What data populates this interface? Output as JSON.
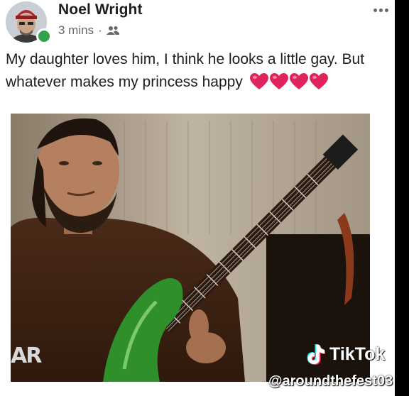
{
  "post": {
    "author": "Noel Wright",
    "time": "3 mins",
    "separator": "·",
    "audience_icon": "friends-icon",
    "text": "My daughter loves him, I think he looks a little gay. But whatever makes my princess happy",
    "hearts_count": 4,
    "heart_color": "#e0245e"
  },
  "media": {
    "channel_logo": "AR"
  },
  "overlay": {
    "brand": "TikTok",
    "handle": "@aroundthefest03"
  },
  "colors": {
    "online": "#31a24c",
    "secondary_text": "#65676b",
    "guitar": "#2f8f2a"
  }
}
